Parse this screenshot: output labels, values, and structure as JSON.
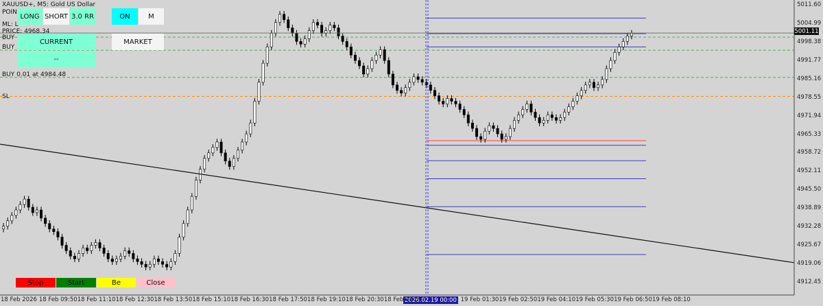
{
  "chart_title": "XAUUSD+, M5:  Gold US Dollar",
  "info": {
    "point_label": "POIN",
    "ml_label": "ML: L",
    "price_label": "PRICE: 4968.34",
    "buy_short_1": "BUY",
    "buy_short_2": "BUY",
    "buy_order": "BUY 0.01 at 4984.48",
    "sl_label": "SL"
  },
  "buttons": {
    "long": "LONG",
    "short": "SHORT",
    "rr": "3.0 RR",
    "on": "ON",
    "m": "M",
    "current": "CURRENT",
    "market": "MARKET",
    "dash": "--"
  },
  "bottom_buttons": {
    "stop": "Stop",
    "start": "Start",
    "be": "Be",
    "close": "Close"
  },
  "current_price": "5001.11",
  "highlighted_date": "2026.02.19 00:00",
  "colors": {
    "background": "#d4d4d4",
    "bull_candle": "#ffffff",
    "bear_candle": "#000000",
    "button_green": "#7fffd4",
    "button_cyan": "#00ffff",
    "stop_red": "#ff0000",
    "start_green": "#008000",
    "be_yellow": "#ffff00",
    "close_pink": "#ffc0cb",
    "level_blue": "#3333bb",
    "level_green_dashed": "#4caf50",
    "sl_orange": "#ff8c00"
  },
  "chart_data": {
    "type": "candlestick",
    "title": "XAUUSD+, M5:  Gold US Dollar",
    "y_ticks": [
      "5011.60",
      "5004.99",
      "4998.38",
      "4991.77",
      "4985.16",
      "4978.55",
      "4971.94",
      "4965.33",
      "4958.72",
      "4952.11",
      "4945.50",
      "4938.89",
      "4932.28",
      "4925.67",
      "4919.06",
      "4912.45"
    ],
    "x_ticks": [
      "18 Feb 2026",
      "18 Feb 09:50",
      "18 Feb 11:10",
      "18 Feb 12:30",
      "18 Feb 13:50",
      "18 Feb 15:10",
      "18 Feb 16:30",
      "18 Feb 17:50",
      "18 Feb 19:10",
      "18 Feb 20:30",
      "18 Feb 21:50",
      "2026.02.19 00:00",
      "19 Feb 01:30",
      "19 Feb 02:50",
      "19 Feb 04:10",
      "19 Feb 05:30",
      "19 Feb 06:50",
      "19 Feb 08:10"
    ],
    "ylim": [
      4910.5,
      5012.5
    ],
    "current_price": 5001.11,
    "horizontal_levels": [
      {
        "price": 5006.6,
        "style": "solid",
        "color": "blue"
      },
      {
        "price": 5000.9,
        "style": "solid",
        "color": "blue"
      },
      {
        "price": 4999.6,
        "style": "dashed",
        "color": "green"
      },
      {
        "price": 4996.0,
        "style": "solid",
        "color": "blue"
      },
      {
        "price": 4994.8,
        "style": "dashed",
        "color": "green"
      },
      {
        "price": 4984.8,
        "style": "dashed",
        "color": "green"
      },
      {
        "price": 4977.8,
        "style": "dashed",
        "color": "orange"
      },
      {
        "price": 4961.5,
        "style": "solid",
        "color": "red"
      },
      {
        "price": 4959.8,
        "style": "solid",
        "color": "blue"
      },
      {
        "price": 4954.1,
        "style": "solid",
        "color": "blue"
      },
      {
        "price": 4947.5,
        "style": "solid",
        "color": "blue"
      },
      {
        "price": 4937.2,
        "style": "solid",
        "color": "blue"
      },
      {
        "price": 4919.6,
        "style": "solid",
        "color": "blue"
      }
    ],
    "trendline": {
      "from_price": 4960.2,
      "to_price": 4916.6
    },
    "closes": [
      4930,
      4932,
      4934,
      4936,
      4938,
      4940,
      4937,
      4935,
      4936,
      4933,
      4931,
      4929,
      4928,
      4926,
      4923,
      4921,
      4919,
      4918,
      4920,
      4922,
      4921,
      4923,
      4924,
      4922,
      4920,
      4918,
      4917,
      4918,
      4919,
      4921,
      4920,
      4918,
      4917,
      4916,
      4915,
      4916,
      4918,
      4917,
      4916,
      4915,
      4917,
      4920,
      4926,
      4931,
      4936,
      4941,
      4947,
      4951,
      4955,
      4957,
      4959,
      4961,
      4957,
      4954,
      4952,
      4955,
      4958,
      4961,
      4964,
      4968,
      4976,
      4983,
      4990,
      4996,
      5001,
      5005,
      5008,
      5006,
      5003,
      5001,
      4998,
      4997,
      4999,
      5002,
      5005,
      5004,
      5001,
      5002,
      5004,
      5003,
      5000,
      4998,
      4996,
      4993,
      4991,
      4989,
      4986,
      4988,
      4991,
      4993,
      4995,
      4991,
      4986,
      4982,
      4980,
      4979,
      4981,
      4983,
      4985,
      4984,
      4983,
      4982,
      4980,
      4978,
      4976,
      4975,
      4977,
      4976,
      4975,
      4973,
      4971,
      4968,
      4966,
      4963,
      4962,
      4965,
      4967,
      4966,
      4964,
      4962,
      4963,
      4966,
      4969,
      4971,
      4973,
      4975,
      4972,
      4970,
      4968,
      4969,
      4971,
      4970,
      4969,
      4970,
      4972,
      4974,
      4976,
      4978,
      4980,
      4982,
      4983,
      4981,
      4982,
      4984,
      4988,
      4991,
      4994,
      4996,
      4998,
      5000,
      5001
    ]
  }
}
